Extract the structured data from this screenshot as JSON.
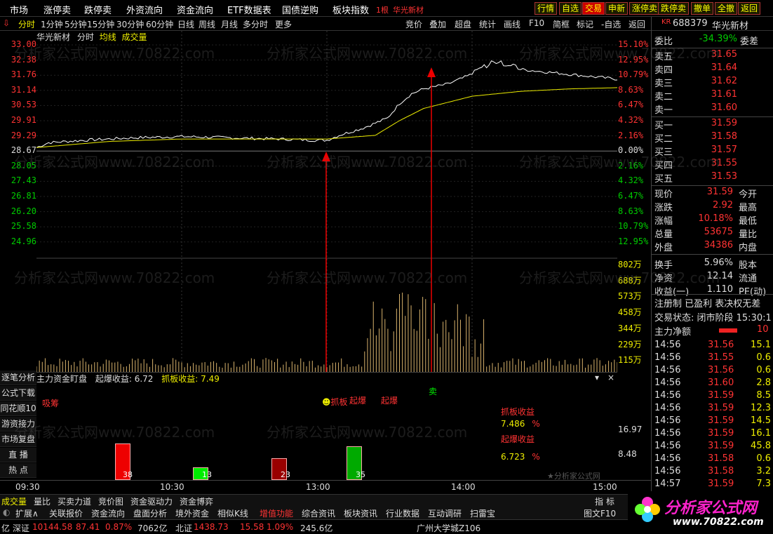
{
  "topmenu": {
    "items": [
      "市场",
      "涨停卖",
      "跌停卖",
      "外资流向",
      "资金流向",
      "ETF数据表",
      "国债逆购",
      "板块指数"
    ],
    "tag": "1根",
    "stock": "华光新材",
    "buttons": [
      "行情",
      "自选",
      "交易",
      "申新",
      "涨停卖",
      "跌停卖",
      "撤单",
      "全撤",
      "返回"
    ]
  },
  "toolbar": {
    "left": [
      "分时",
      "1分钟",
      "5分钟",
      "15分钟",
      "30分钟",
      "60分钟",
      "日线",
      "周线",
      "月线",
      "多分时",
      "更多"
    ],
    "right": [
      "竞价",
      "叠加",
      "超盘",
      "统计",
      "画线",
      "F10",
      "简框",
      "标记",
      "-自选",
      "返回"
    ]
  },
  "chart_header": {
    "name": "华光新材",
    "mode": "分时",
    "avg": "均线",
    "vol": "成交量"
  },
  "price_axis": {
    "left": [
      "33.00",
      "32.38",
      "31.76",
      "31.14",
      "30.53",
      "29.91",
      "29.29",
      "28.67",
      "28.05",
      "27.43",
      "26.81",
      "26.20",
      "25.58",
      "24.96"
    ],
    "right": [
      "15.10%",
      "12.95%",
      "10.79%",
      "8.63%",
      "6.47%",
      "4.32%",
      "2.16%",
      "0.00%",
      "2.16%",
      "4.32%",
      "6.47%",
      "8.63%",
      "10.79%",
      "12.95%"
    ]
  },
  "vol_axis": [
    "802万",
    "688万",
    "573万",
    "458万",
    "344万",
    "229万",
    "115万"
  ],
  "time_axis": [
    "09:30",
    "10:30",
    "13:00",
    "14:00",
    "15:00"
  ],
  "annotations": {
    "buy": "抓板",
    "blast1": "起爆",
    "blast2": "起爆",
    "sell": "卖"
  },
  "sub_panel": {
    "title": "主力资金盯盘",
    "blast_label": "起爆收益:",
    "blast_val": "6.72",
    "catch_label": "抓板收益:",
    "catch_val": "7.49",
    "absorb": "吸筹",
    "catch_title": "抓板收益",
    "catch_num": "7.486",
    "blast_title": "起爆收益",
    "blast_num": "6.723",
    "pct": "%",
    "axis": [
      "16.97",
      "8.48"
    ],
    "bars": [
      {
        "label": "38",
        "value": 38,
        "color": "#e00"
      },
      {
        "label": "13",
        "value": 13,
        "color": "#0e0"
      },
      {
        "label": "23",
        "value": 23,
        "color": "#900"
      },
      {
        "label": "35",
        "value": 35,
        "color": "#0a0"
      }
    ],
    "credit": "★分析家公式网"
  },
  "side_buttons": [
    "逐笔分析",
    "公式下载",
    "同花顺10",
    "游资接力",
    "市场复盘",
    "直 播",
    "热 点"
  ],
  "stock_panel": {
    "code": "688379",
    "name": "华光新材",
    "tag": "KR",
    "wb": {
      "label": "委比",
      "value": "-34.39%",
      "right": "委差"
    },
    "asks": [
      {
        "l": "卖五",
        "p": "31.65"
      },
      {
        "l": "卖四",
        "p": "31.64"
      },
      {
        "l": "卖三",
        "p": "31.62"
      },
      {
        "l": "卖二",
        "p": "31.61"
      },
      {
        "l": "卖一",
        "p": "31.60"
      }
    ],
    "bids": [
      {
        "l": "买一",
        "p": "31.59"
      },
      {
        "l": "买二",
        "p": "31.58"
      },
      {
        "l": "买三",
        "p": "31.57"
      },
      {
        "l": "买四",
        "p": "31.55"
      },
      {
        "l": "买五",
        "p": "31.53"
      }
    ],
    "stats": [
      {
        "l": "现价",
        "v": "31.59",
        "r": "今开"
      },
      {
        "l": "涨跌",
        "v": "2.92",
        "r": "最高"
      },
      {
        "l": "涨幅",
        "v": "10.18%",
        "r": "最低"
      },
      {
        "l": "总量",
        "v": "53675",
        "r": "量比"
      },
      {
        "l": "外盘",
        "v": "34386",
        "r": "内盘"
      },
      {
        "l": "换手",
        "v": "5.96%",
        "r": "股本"
      },
      {
        "l": "净资",
        "v": "12.14",
        "r": "流通"
      },
      {
        "l": "收益(一)",
        "v": "1.110",
        "r": "PE(动)"
      }
    ],
    "info1": "注册制 已盈利 表决权无差",
    "info2": "交易状态: 闭市阶段 15:30:1",
    "flow_label": "主力净额",
    "flow_val": "10",
    "ticks": [
      [
        "14:56",
        "31.56",
        "15.1"
      ],
      [
        "14:56",
        "31.55",
        "0.6"
      ],
      [
        "14:56",
        "31.56",
        "0.6"
      ],
      [
        "14:56",
        "31.60",
        "2.8"
      ],
      [
        "14:56",
        "31.59",
        "8.5"
      ],
      [
        "14:56",
        "31.59",
        "12.3"
      ],
      [
        "14:56",
        "31.59",
        "14.5"
      ],
      [
        "14:56",
        "31.59",
        "16.1"
      ],
      [
        "14:56",
        "31.59",
        "45.8"
      ],
      [
        "14:56",
        "31.58",
        "0.6"
      ],
      [
        "14:56",
        "31.58",
        "3.2"
      ],
      [
        "14:57",
        "31.59",
        "7.3"
      ]
    ]
  },
  "bottom": {
    "row1": [
      "成交量",
      "量比",
      "买卖力道",
      "竞价图",
      "资金驱动力",
      "资金博弈"
    ],
    "row1r": [
      "指",
      "标"
    ],
    "row2": [
      "扩展∧",
      "关联报价",
      "资金流向",
      "盘面分析",
      "境外资金",
      "相似K线",
      "增值功能",
      "综合资讯",
      "板块资讯",
      "行业数据",
      "互动调研",
      "扫雷宝"
    ],
    "row2r": "图文F10",
    "row3": {
      "a": "亿",
      "b": "深证",
      "c": "10144.58",
      "d": "87.41",
      "e": "0.87%",
      "f": "7062亿",
      "g": "北证",
      "h": "1438.73",
      "i": "15.58",
      "j": "1.09%",
      "k": "245.6亿",
      "l": "广州大学城Z106"
    }
  },
  "logo": {
    "cn": "分析家公式网",
    "url": "www.70822.com"
  },
  "watermark": "分析家公式网www.70822.com",
  "chart_data": {
    "type": "line",
    "prev_close": 28.67,
    "times": [
      "09:30",
      "10:30",
      "13:00",
      "14:00",
      "15:00"
    ],
    "price": [
      [
        0,
        28.8
      ],
      [
        5,
        29.0
      ],
      [
        20,
        29.1
      ],
      [
        40,
        29.2
      ],
      [
        60,
        29.25
      ],
      [
        80,
        29.2
      ],
      [
        100,
        29.15
      ],
      [
        115,
        29.1
      ],
      [
        120,
        29.1
      ],
      [
        125,
        29.3
      ],
      [
        135,
        29.6
      ],
      [
        145,
        30.0
      ],
      [
        150,
        30.6
      ],
      [
        155,
        31.0
      ],
      [
        160,
        31.2
      ],
      [
        170,
        31.4
      ],
      [
        180,
        31.8
      ],
      [
        190,
        32.3
      ],
      [
        200,
        32.0
      ],
      [
        210,
        31.9
      ],
      [
        220,
        31.8
      ],
      [
        230,
        31.7
      ],
      [
        240,
        31.6
      ]
    ],
    "avg": [
      [
        0,
        28.8
      ],
      [
        30,
        29.05
      ],
      [
        60,
        29.15
      ],
      [
        100,
        29.15
      ],
      [
        120,
        29.15
      ],
      [
        140,
        29.3
      ],
      [
        150,
        29.9
      ],
      [
        160,
        30.4
      ],
      [
        180,
        30.9
      ],
      [
        200,
        31.1
      ],
      [
        220,
        31.2
      ],
      [
        240,
        31.25
      ]
    ],
    "volume_peak_index": [
      150,
      152,
      155,
      165,
      170,
      175
    ]
  }
}
